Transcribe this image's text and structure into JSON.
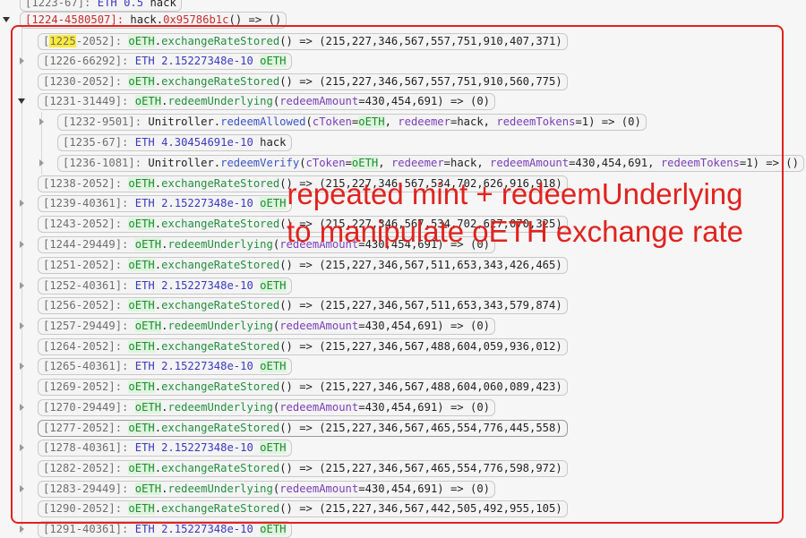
{
  "annotation": {
    "line1": "repeated mint + redeemUnderlying",
    "line2": "to manipulate oETH exchange rate",
    "color": "#e0231f"
  },
  "rows": [
    {
      "id": "1223-67",
      "id_hl": "",
      "id_rest": "",
      "parts": [
        [
          "eth",
          "ETH 0.5 "
        ],
        [
          "ctrl",
          "hack"
        ]
      ]
    },
    {
      "id": "1224-4580507",
      "id_hl": "",
      "id_rest": "",
      "parts": [
        [
          "ctrl",
          "hack."
        ],
        [
          "hex",
          "0x95786b1c"
        ],
        [
          "ctrl",
          "() => ()"
        ]
      ]
    },
    {
      "id": "",
      "id_hl": "1225",
      "id_rest": "-2052",
      "parts": [
        [
          "ctr",
          "oETH"
        ],
        [
          "ctrl",
          "."
        ],
        [
          "fn-green",
          "exchangeRateStored"
        ],
        [
          "ctrl",
          "() => (215,227,346,567,557,751,910,407,371)"
        ]
      ]
    },
    {
      "id": "1226-66292",
      "id_hl": "",
      "id_rest": "",
      "parts": [
        [
          "eth",
          "ETH 2.15227348e-10 "
        ],
        [
          "ctr",
          "oETH"
        ]
      ]
    },
    {
      "id": "1230-2052",
      "id_hl": "",
      "id_rest": "",
      "parts": [
        [
          "ctr",
          "oETH"
        ],
        [
          "ctrl",
          "."
        ],
        [
          "fn-green",
          "exchangeRateStored"
        ],
        [
          "ctrl",
          "() => (215,227,346,567,557,751,910,560,775)"
        ]
      ]
    },
    {
      "id": "1231-31449",
      "id_hl": "",
      "id_rest": "",
      "parts": [
        [
          "ctr",
          "oETH"
        ],
        [
          "ctrl",
          "."
        ],
        [
          "fn-green",
          "redeemUnderlying"
        ],
        [
          "ctrl",
          "("
        ],
        [
          "pn",
          "redeemAmount"
        ],
        [
          "ctrl",
          "=430,454,691) => (0)"
        ]
      ]
    },
    {
      "id": "1232-9501",
      "id_hl": "",
      "id_rest": "",
      "parts": [
        [
          "ctrl",
          "Unitroller."
        ],
        [
          "fn-blue",
          "redeemAllowed"
        ],
        [
          "ctrl",
          "("
        ],
        [
          "pn",
          "cToken"
        ],
        [
          "ctrl",
          "="
        ],
        [
          "ctr",
          "oETH"
        ],
        [
          "ctrl",
          ", "
        ],
        [
          "pn",
          "redeemer"
        ],
        [
          "ctrl",
          "=hack, "
        ],
        [
          "pn",
          "redeemTokens"
        ],
        [
          "ctrl",
          "=1) => (0)"
        ]
      ]
    },
    {
      "id": "1235-67",
      "id_hl": "",
      "id_rest": "",
      "parts": [
        [
          "eth",
          "ETH 4.30454691e-10 "
        ],
        [
          "ctrl",
          "hack"
        ]
      ]
    },
    {
      "id": "1236-1081",
      "id_hl": "",
      "id_rest": "",
      "parts": [
        [
          "ctrl",
          "Unitroller."
        ],
        [
          "fn-blue",
          "redeemVerify"
        ],
        [
          "ctrl",
          "("
        ],
        [
          "pn",
          "cToken"
        ],
        [
          "ctrl",
          "="
        ],
        [
          "ctr",
          "oETH"
        ],
        [
          "ctrl",
          ", "
        ],
        [
          "pn",
          "redeemer"
        ],
        [
          "ctrl",
          "=hack, "
        ],
        [
          "pn",
          "redeemAmount"
        ],
        [
          "ctrl",
          "=430,454,691, "
        ],
        [
          "pn",
          "redeemTokens"
        ],
        [
          "ctrl",
          "=1) => ()"
        ]
      ]
    },
    {
      "id": "1238-2052",
      "id_hl": "",
      "id_rest": "",
      "parts": [
        [
          "ctr",
          "oETH"
        ],
        [
          "ctrl",
          "."
        ],
        [
          "fn-green",
          "exchangeRateStored"
        ],
        [
          "ctrl",
          "() => (215,227,346,567,534,702,626,916,918)"
        ]
      ]
    },
    {
      "id": "1239-40361",
      "id_hl": "",
      "id_rest": "",
      "parts": [
        [
          "eth",
          "ETH 2.15227348e-10 "
        ],
        [
          "ctr",
          "oETH"
        ]
      ]
    },
    {
      "id": "1243-2052",
      "id_hl": "",
      "id_rest": "",
      "parts": [
        [
          "ctr",
          "oETH"
        ],
        [
          "ctrl",
          "."
        ],
        [
          "fn-green",
          "exchangeRateStored"
        ],
        [
          "ctrl",
          "() => (215,227,346,567,534,702,627,070,325)"
        ]
      ]
    },
    {
      "id": "1244-29449",
      "id_hl": "",
      "id_rest": "",
      "parts": [
        [
          "ctr",
          "oETH"
        ],
        [
          "ctrl",
          "."
        ],
        [
          "fn-green",
          "redeemUnderlying"
        ],
        [
          "ctrl",
          "("
        ],
        [
          "pn",
          "redeemAmount"
        ],
        [
          "ctrl",
          "=430,454,691) => (0)"
        ]
      ]
    },
    {
      "id": "1251-2052",
      "id_hl": "",
      "id_rest": "",
      "parts": [
        [
          "ctr",
          "oETH"
        ],
        [
          "ctrl",
          "."
        ],
        [
          "fn-green",
          "exchangeRateStored"
        ],
        [
          "ctrl",
          "() => (215,227,346,567,511,653,343,426,465)"
        ]
      ]
    },
    {
      "id": "1252-40361",
      "id_hl": "",
      "id_rest": "",
      "parts": [
        [
          "eth",
          "ETH 2.15227348e-10 "
        ],
        [
          "ctr",
          "oETH"
        ]
      ]
    },
    {
      "id": "1256-2052",
      "id_hl": "",
      "id_rest": "",
      "parts": [
        [
          "ctr",
          "oETH"
        ],
        [
          "ctrl",
          "."
        ],
        [
          "fn-green",
          "exchangeRateStored"
        ],
        [
          "ctrl",
          "() => (215,227,346,567,511,653,343,579,874)"
        ]
      ]
    },
    {
      "id": "1257-29449",
      "id_hl": "",
      "id_rest": "",
      "parts": [
        [
          "ctr",
          "oETH"
        ],
        [
          "ctrl",
          "."
        ],
        [
          "fn-green",
          "redeemUnderlying"
        ],
        [
          "ctrl",
          "("
        ],
        [
          "pn",
          "redeemAmount"
        ],
        [
          "ctrl",
          "=430,454,691) => (0)"
        ]
      ]
    },
    {
      "id": "1264-2052",
      "id_hl": "",
      "id_rest": "",
      "parts": [
        [
          "ctr",
          "oETH"
        ],
        [
          "ctrl",
          "."
        ],
        [
          "fn-green",
          "exchangeRateStored"
        ],
        [
          "ctrl",
          "() => (215,227,346,567,488,604,059,936,012)"
        ]
      ]
    },
    {
      "id": "1265-40361",
      "id_hl": "",
      "id_rest": "",
      "parts": [
        [
          "eth",
          "ETH 2.15227348e-10 "
        ],
        [
          "ctr",
          "oETH"
        ]
      ]
    },
    {
      "id": "1269-2052",
      "id_hl": "",
      "id_rest": "",
      "parts": [
        [
          "ctr",
          "oETH"
        ],
        [
          "ctrl",
          "."
        ],
        [
          "fn-green",
          "exchangeRateStored"
        ],
        [
          "ctrl",
          "() => (215,227,346,567,488,604,060,089,423)"
        ]
      ]
    },
    {
      "id": "1270-29449",
      "id_hl": "",
      "id_rest": "",
      "parts": [
        [
          "ctr",
          "oETH"
        ],
        [
          "ctrl",
          "."
        ],
        [
          "fn-green",
          "redeemUnderlying"
        ],
        [
          "ctrl",
          "("
        ],
        [
          "pn",
          "redeemAmount"
        ],
        [
          "ctrl",
          "=430,454,691) => (0)"
        ]
      ]
    },
    {
      "id": "1277-2052",
      "id_hl": "",
      "id_rest": "",
      "parts": [
        [
          "ctr",
          "oETH"
        ],
        [
          "ctrl",
          "."
        ],
        [
          "fn-green",
          "exchangeRateStored"
        ],
        [
          "ctrl",
          "() => (215,227,346,567,465,554,776,445,558)"
        ]
      ]
    },
    {
      "id": "1278-40361",
      "id_hl": "",
      "id_rest": "",
      "parts": [
        [
          "eth",
          "ETH 2.15227348e-10 "
        ],
        [
          "ctr",
          "oETH"
        ]
      ]
    },
    {
      "id": "1282-2052",
      "id_hl": "",
      "id_rest": "",
      "parts": [
        [
          "ctr",
          "oETH"
        ],
        [
          "ctrl",
          "."
        ],
        [
          "fn-green",
          "exchangeRateStored"
        ],
        [
          "ctrl",
          "() => (215,227,346,567,465,554,776,598,972)"
        ]
      ]
    },
    {
      "id": "1283-29449",
      "id_hl": "",
      "id_rest": "",
      "parts": [
        [
          "ctr",
          "oETH"
        ],
        [
          "ctrl",
          "."
        ],
        [
          "fn-green",
          "redeemUnderlying"
        ],
        [
          "ctrl",
          "("
        ],
        [
          "pn",
          "redeemAmount"
        ],
        [
          "ctrl",
          "=430,454,691) => (0)"
        ]
      ]
    },
    {
      "id": "1290-2052",
      "id_hl": "",
      "id_rest": "",
      "parts": [
        [
          "ctr",
          "oETH"
        ],
        [
          "ctrl",
          "."
        ],
        [
          "fn-green",
          "exchangeRateStored"
        ],
        [
          "ctrl",
          "() => (215,227,346,567,442,505,492,955,105)"
        ]
      ]
    },
    {
      "id": "1291-40361",
      "id_hl": "",
      "id_rest": "",
      "parts": [
        [
          "eth",
          "ETH 2.15227348e-10 "
        ],
        [
          "ctr",
          "oETH"
        ]
      ]
    }
  ]
}
